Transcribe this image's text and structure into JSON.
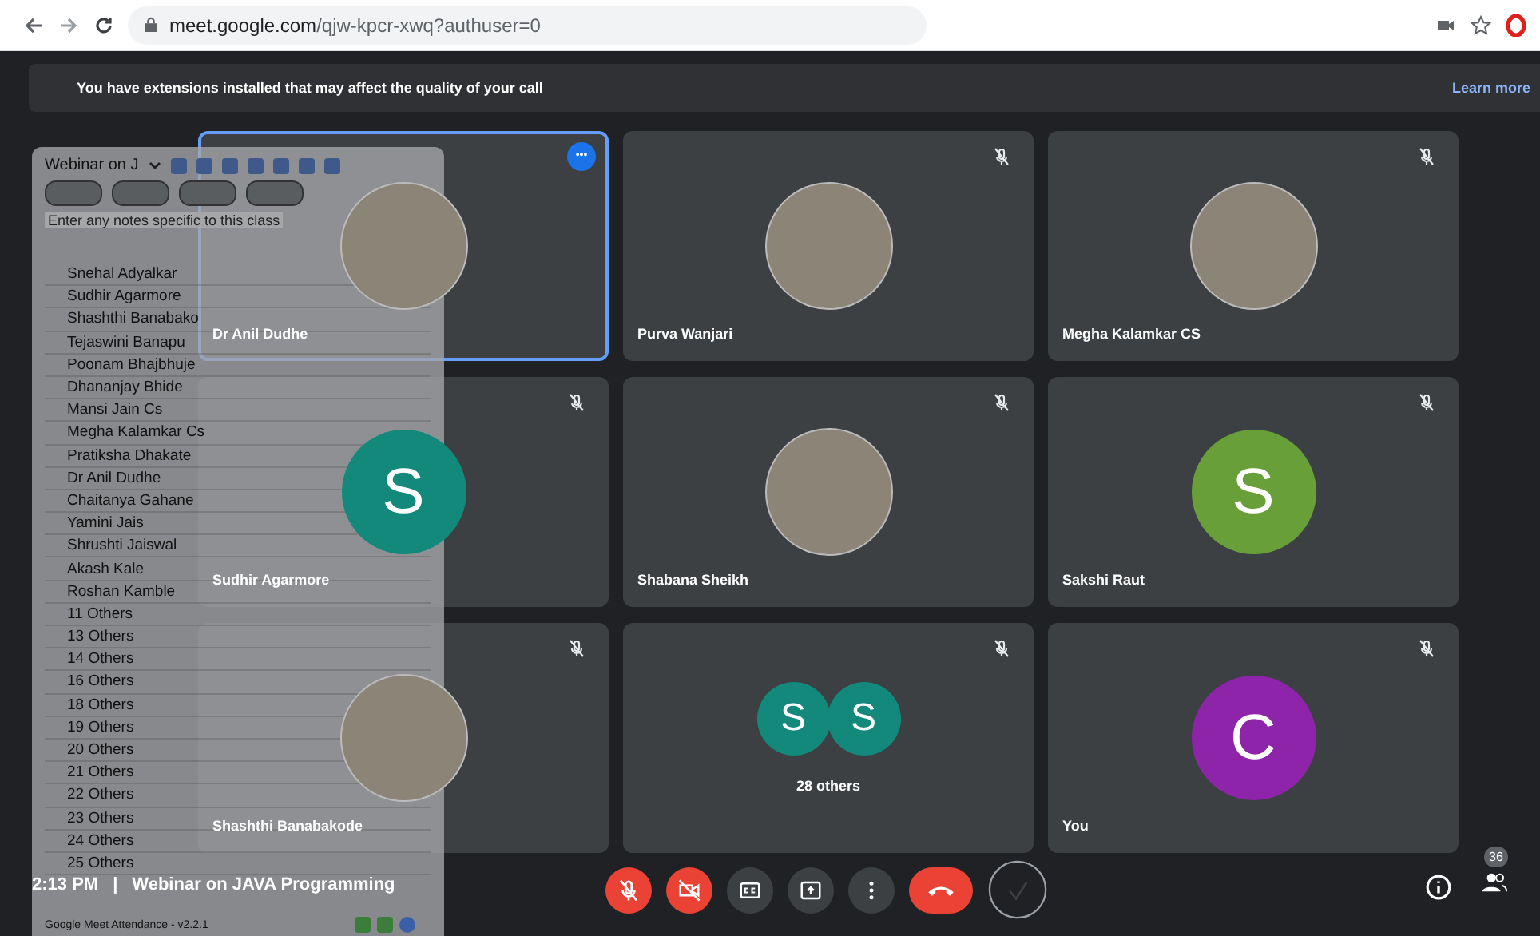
{
  "browser": {
    "url_host": "meet.google.com",
    "url_path": "/qjw-kpcr-xwq?authuser=0"
  },
  "banner": {
    "text": "You have extensions installed that may affect the quality of your call",
    "link": "Learn more"
  },
  "tiles": [
    {
      "name": "Dr Anil Dudhe",
      "kind": "photo",
      "speaking": true,
      "muted": false,
      "more": "•••"
    },
    {
      "name": "Purva Wanjari",
      "kind": "photo",
      "speaking": false,
      "muted": true
    },
    {
      "name": "Megha Kalamkar CS",
      "kind": "photo",
      "speaking": false,
      "muted": true
    },
    {
      "name": "Sudhir Agarmore",
      "kind": "initial",
      "initial": "S",
      "color": "#12897b",
      "speaking": false,
      "muted": true
    },
    {
      "name": "Shabana Sheikh",
      "kind": "photo",
      "speaking": false,
      "muted": true
    },
    {
      "name": "Sakshi Raut",
      "kind": "initial",
      "initial": "S",
      "color": "#689f38",
      "speaking": false,
      "muted": true
    },
    {
      "name": "Shashthi Banabakode",
      "kind": "photo",
      "speaking": false,
      "muted": true
    },
    {
      "kind": "group",
      "initials": [
        "S",
        "S"
      ],
      "color": "#12897b",
      "count": "28 others",
      "speaking": false,
      "muted": true
    },
    {
      "name": "You",
      "kind": "initial",
      "initial": "C",
      "color": "#8e24aa",
      "speaking": false,
      "muted": true
    }
  ],
  "panel": {
    "class_name": "Webinar on J",
    "notes_placeholder": "Enter any notes specific to this class",
    "students": [
      "Snehal Adyalkar",
      "Sudhir Agarmore",
      "Shashthi Banabako",
      "Tejaswini Banapu",
      "Poonam Bhajbhuje",
      "Dhananjay Bhide",
      "Mansi Jain Cs",
      "Megha Kalamkar Cs",
      "Pratiksha Dhakate",
      "Dr Anil Dudhe",
      "Chaitanya Gahane",
      "Yamini Jais",
      "Shrushti Jaiswal",
      "Akash Kale",
      "Roshan Kamble",
      "11 Others",
      "13 Others",
      "14 Others",
      "16 Others",
      "18 Others",
      "19 Others",
      "20 Others",
      "21 Others",
      "22 Others",
      "23 Others",
      "24 Others",
      "25 Others"
    ],
    "footer": "Google Meet Attendance - v2.2.1"
  },
  "meeting": {
    "time": "2:13 PM",
    "separator": "|",
    "title": "Webinar on JAVA Programming",
    "participants": "36"
  }
}
